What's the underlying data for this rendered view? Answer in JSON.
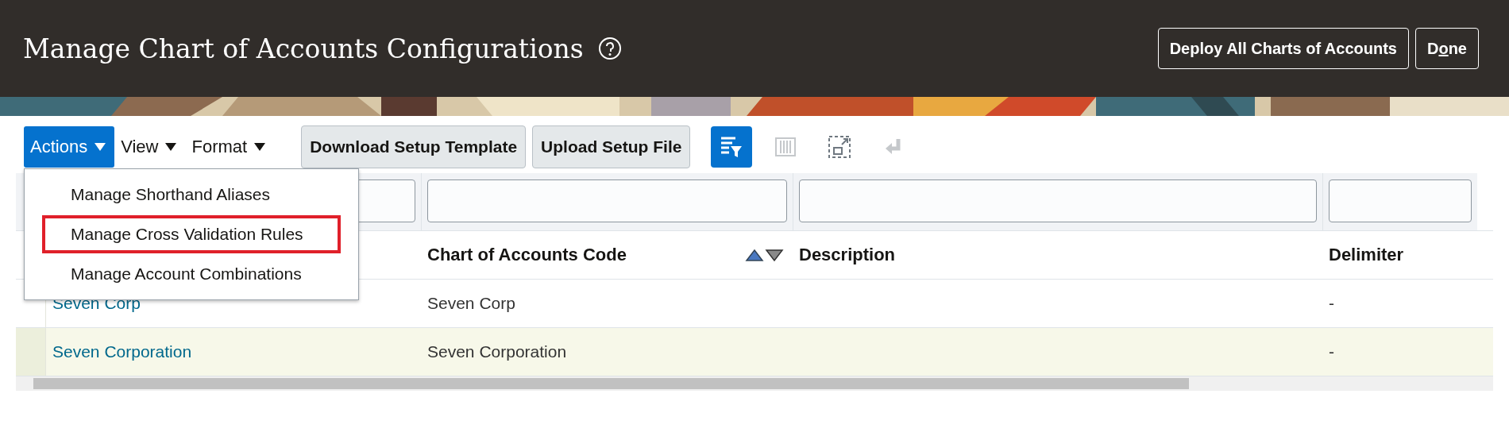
{
  "header": {
    "title": "Manage Chart of Accounts Configurations",
    "buttons": [
      {
        "label": "Deploy All Charts of Accounts"
      },
      {
        "label": "D",
        "access_key": "o",
        "rest": "ne"
      }
    ]
  },
  "toolbar": {
    "menus": [
      {
        "label": "Actions",
        "expanded": true
      },
      {
        "label": "View",
        "expanded": false
      },
      {
        "label": "Format",
        "expanded": false
      }
    ],
    "buttons": [
      "Download Setup Template",
      "Upload Setup File"
    ],
    "icons": [
      {
        "kind": "filter",
        "selected": true,
        "disabled": false
      },
      {
        "kind": "columns",
        "selected": false,
        "disabled": true
      },
      {
        "kind": "detach",
        "selected": false,
        "disabled": false
      },
      {
        "kind": "wrap",
        "selected": false,
        "disabled": true
      }
    ]
  },
  "actions_menu": {
    "items": [
      {
        "label": "Manage Shorthand Aliases",
        "outlined": false
      },
      {
        "label": "Manage Cross Validation Rules",
        "outlined": true
      },
      {
        "label": "Manage Account Combinations",
        "outlined": false
      }
    ]
  },
  "table": {
    "columns": [
      {
        "label": "Chart of Accounts Code",
        "sortable": true
      },
      {
        "label": "Description",
        "sortable": false
      },
      {
        "label": "Delimiter",
        "sortable": false
      }
    ],
    "rows": [
      {
        "name": "Seven Corp",
        "code": "Seven Corp",
        "description": "",
        "delimiter": "-",
        "selected": false
      },
      {
        "name": "Seven Corporation",
        "code": "Seven Corporation",
        "description": "",
        "delimiter": "-",
        "selected": true
      }
    ]
  }
}
